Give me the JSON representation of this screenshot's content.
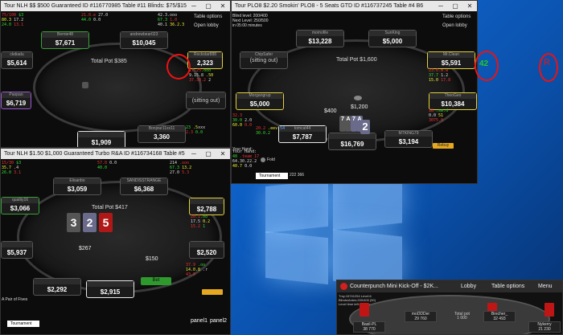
{
  "annotations": {
    "circle_label_1": "42",
    "circle_label_2": "R"
  },
  "table1": {
    "title": "Tour NLH $$ $500 Guaranteed  ID #116770985 Table #11 Blinds: $75/$15",
    "pot": "Total Pot $385",
    "seats": [
      {
        "name": "Bernie48",
        "stack": "$7,671"
      },
      {
        "name": "andrewbear023",
        "stack": "$10,045"
      },
      {
        "name": "Rockstar888",
        "stack": "2,323"
      },
      {
        "name": "ckdiadu",
        "stack": "$5,614"
      },
      {
        "name": "Paopao",
        "stack": "$6,719"
      },
      {
        "name": "",
        "stack": "(sitting out)"
      },
      {
        "name": "",
        "stack": "$1,909"
      },
      {
        "name": "Bonjour11xx11",
        "stack": "3,360"
      }
    ],
    "options": [
      "Table options",
      "Open lobby"
    ]
  },
  "table2": {
    "title": "Tour PLO8 $2.20 Smokin' PLO8 - 5 Seats GTD ID #116737245 Table #4 B6",
    "blind_level": "Blind level: 200/400",
    "next_level": "Next Level: 250/500",
    "time": "in 05:00 minutes",
    "pot": "Total Pot $1,600",
    "seats": [
      {
        "name": "momofile",
        "stack": "$13,228"
      },
      {
        "name": "SunKing",
        "stack": "$5,000"
      },
      {
        "name": "ChipSafer",
        "stack": "(sitting out)"
      },
      {
        "name": "Mr.Clean",
        "stack": "$5,591"
      },
      {
        "name": "Morgangrup",
        "stack": "$5,000"
      },
      {
        "name": "TheoGeo",
        "stack": "$10,384"
      },
      {
        "name": "tomcat44",
        "stack": "$7,787"
      },
      {
        "name": "",
        "stack": "$16,769"
      },
      {
        "name": "MTKING79",
        "stack": "$3,194"
      }
    ],
    "bets": [
      "$400",
      "$1,200"
    ],
    "hand": [
      "7",
      "A",
      "7",
      "A",
      "2"
    ],
    "options": [
      "Table options",
      "Open lobby"
    ],
    "your_hand": "Your Hand:",
    "tournament": "Tournament",
    "fold": "Fold",
    "rebuy": "Rebuy",
    "hud_counts": "222  366"
  },
  "table3": {
    "title": "Tour NLH $1.50 $1,000 Guaranteed Turbo R&A ID #116734168 Table #5",
    "pot": "Total Pot $417",
    "seats": [
      {
        "name": "Elisanbo",
        "stack": "$3,059"
      },
      {
        "name": "SANDISSTRANGE",
        "stack": "$6,368"
      },
      {
        "name": "quality16",
        "stack": "$3,066"
      },
      {
        "name": "",
        "stack": "$2,788"
      },
      {
        "name": "",
        "stack": "$5,937"
      },
      {
        "name": "",
        "stack": "$2,520"
      },
      {
        "name": "",
        "stack": "$2,292"
      },
      {
        "name": "",
        "stack": "$2,915"
      }
    ],
    "board": [
      "3",
      "2",
      "5"
    ],
    "bets": [
      "$267",
      "$150"
    ],
    "bet_button": "Bet",
    "tournament": "Tournament",
    "footer_hint": "A Pair of Fives",
    "panel_labels": [
      "panel1",
      "panel2"
    ]
  },
  "counterpunch": {
    "title": "Counterpunch Mini Kick-Off - $2K...",
    "menu": [
      "Lobby",
      "Table options",
      "Menu"
    ],
    "info": "Tmy:15741254 Level:6\nBlinds/Antes:200/400 (50)\nLevel time left: 6 mins",
    "pot_label": "Total pot",
    "pot_value": "1 000",
    "seats": [
      {
        "name": "Basil-PL",
        "stack": "38 770"
      },
      {
        "name": "moDDDer",
        "stack": "29 760"
      },
      {
        "name": "Brecher_",
        "stack": "32 493"
      },
      {
        "name": "Nykerry",
        "stack": "21 230"
      }
    ]
  },
  "colors": {
    "accent_red": "#e11111",
    "seat_green": "#3aa03a",
    "seat_yellow": "#e3d23a"
  }
}
